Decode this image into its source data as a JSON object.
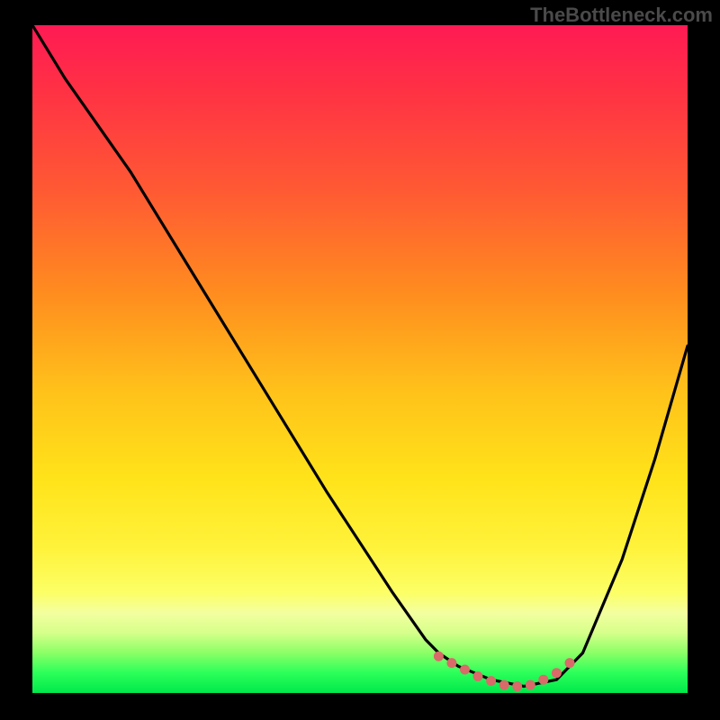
{
  "watermark": "TheBottleneck.com",
  "chart_data": {
    "type": "line",
    "title": "",
    "xlabel": "",
    "ylabel": "",
    "xlim": [
      0,
      100
    ],
    "ylim": [
      0,
      100
    ],
    "grid": false,
    "background_gradient_top_color": "#ff1a53",
    "background_gradient_bottom_color": "#00e84a",
    "series": [
      {
        "name": "curve",
        "color": "#000000",
        "x": [
          0,
          5,
          15,
          25,
          35,
          45,
          55,
          60,
          62,
          65,
          70,
          75,
          80,
          82,
          84,
          90,
          95,
          100
        ],
        "values": [
          100,
          92,
          78,
          62,
          46,
          30,
          15,
          8,
          6,
          4,
          2,
          1,
          2,
          4,
          6,
          20,
          35,
          52
        ]
      }
    ],
    "markers": {
      "name": "bottom-dots",
      "color": "#d86a6a",
      "style": "dotted-segment",
      "x": [
        62,
        64,
        66,
        68,
        70,
        72,
        74,
        76,
        78,
        80,
        82
      ],
      "values": [
        5.5,
        4.5,
        3.5,
        2.5,
        1.8,
        1.2,
        1.0,
        1.2,
        2.0,
        3.0,
        4.5
      ]
    }
  }
}
